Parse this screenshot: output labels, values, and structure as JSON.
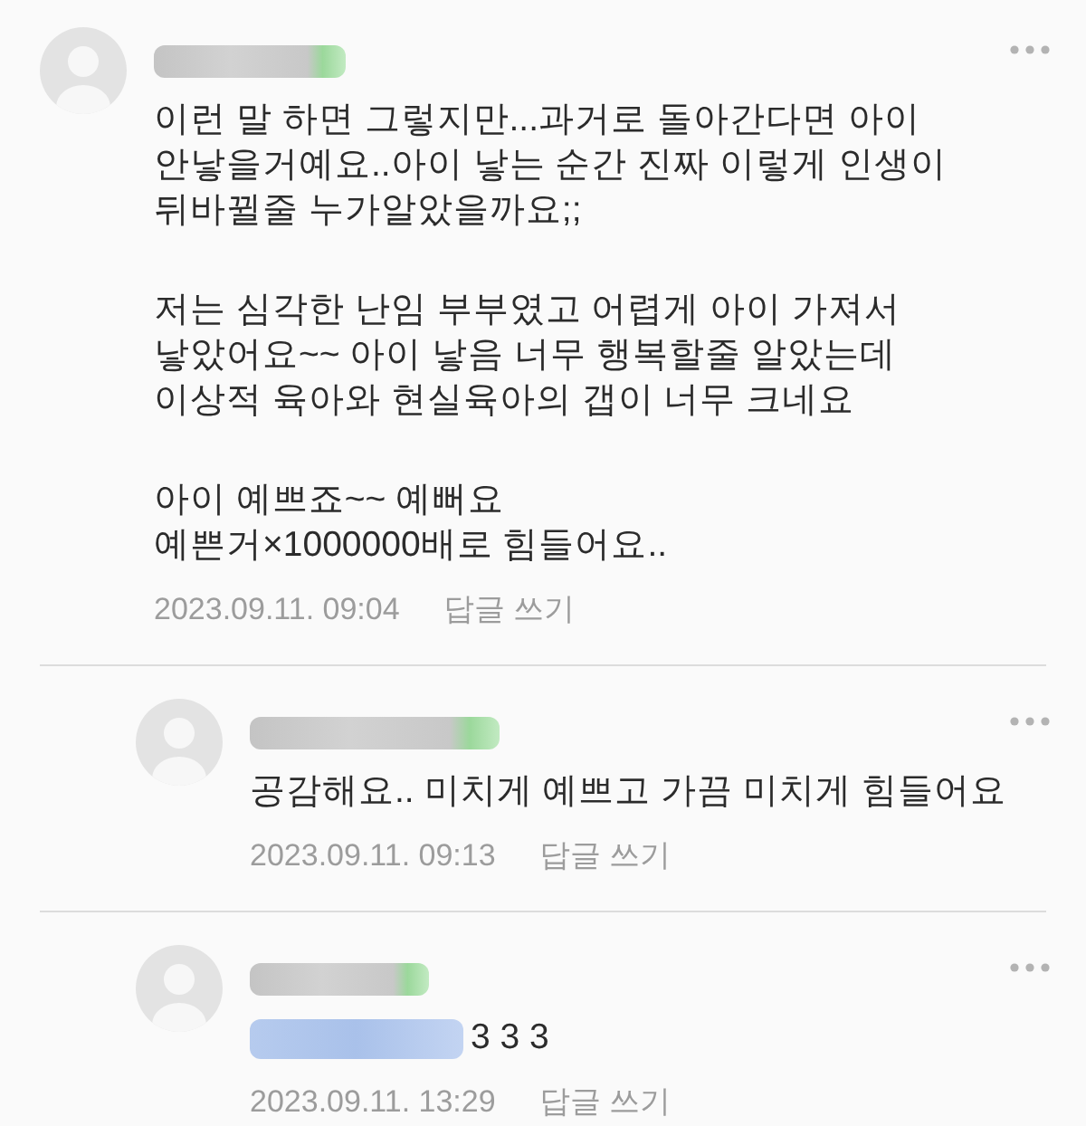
{
  "comments": [
    {
      "paragraphs": [
        "이런 말 하면 그렇지만...과거로 돌아간다면 아이\n안낳을거예요..아이 낳는 순간 진짜 이렇게 인생이\n뒤바뀔줄 누가알았을까요;;",
        "저는 심각한 난임 부부였고 어렵게 아이 가져서\n낳았어요~~ 아이 낳음 너무 행복할줄 알았는데\n이상적 육아와 현실육아의 갭이 너무 크네요",
        "아이 예쁘죠~~ 예뻐요\n예쁜거×1000000배로 힘들어요.."
      ],
      "date": "2023.09.11. 09:04",
      "reply_link": "답글 쓰기",
      "mention": false,
      "children": [
        {
          "paragraphs": [
            "공감해요.. 미치게 예쁘고 가끔 미치게 힘들어요"
          ],
          "date": "2023.09.11. 09:13",
          "reply_link": "답글 쓰기",
          "mention": false
        },
        {
          "paragraphs": [
            "3 3 3"
          ],
          "date": "2023.09.11. 13:29",
          "reply_link": "답글 쓰기",
          "mention": true
        }
      ]
    }
  ]
}
